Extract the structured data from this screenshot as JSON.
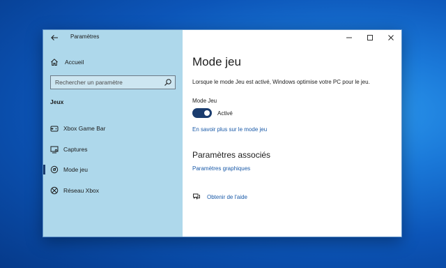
{
  "window": {
    "title": "Paramètres"
  },
  "sidebar": {
    "home_label": "Accueil",
    "search": {
      "placeholder": "Rechercher un paramètre"
    },
    "section_title": "Jeux",
    "items": [
      {
        "label": "Xbox Game Bar",
        "icon": "xbox-game-bar-icon",
        "active": false
      },
      {
        "label": "Captures",
        "icon": "captures-icon",
        "active": false
      },
      {
        "label": "Mode jeu",
        "icon": "game-mode-icon",
        "active": true
      },
      {
        "label": "Réseau Xbox",
        "icon": "xbox-icon",
        "active": false
      }
    ]
  },
  "main": {
    "title": "Mode jeu",
    "description": "Lorsque le mode Jeu est activé, Windows optimise votre PC pour le jeu.",
    "toggle": {
      "label": "Mode Jeu",
      "state_text": "Activé",
      "on": true
    },
    "learn_more_link": "En savoir plus sur le mode jeu",
    "related_title": "Paramètres associés",
    "graphics_link": "Paramètres graphiques",
    "help_link": "Obtenir de l'aide"
  },
  "colors": {
    "sidebar_bg": "#aed8eb",
    "accent": "#1a3c6e",
    "link": "#1a5aa8",
    "desktop": "#1a78d8"
  }
}
